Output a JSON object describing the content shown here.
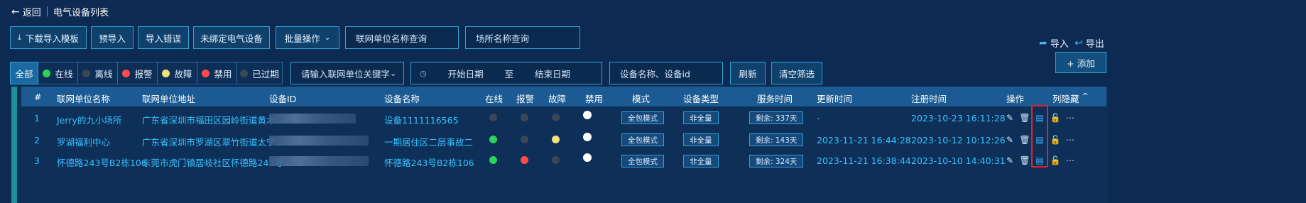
{
  "header": {
    "back_label": "返回",
    "title": "电气设备列表"
  },
  "toolbar": {
    "download_template": "下载导入模板",
    "pre_import": "预导入",
    "import_errors": "导入错误",
    "unbound": "未绑定电气设备",
    "batch": "批量操作",
    "unit_search_placeholder": "联网单位名称查询",
    "place_search_placeholder": "场所名称查询",
    "import_label": "导入",
    "export_label": "导出"
  },
  "filters": {
    "status_items": [
      {
        "label": "全部",
        "color": ""
      },
      {
        "label": "在线",
        "color": "#2bd45a"
      },
      {
        "label": "离线",
        "color": "#3b4656"
      },
      {
        "label": "报警",
        "color": "#ff4a4a"
      },
      {
        "label": "故障",
        "color": "#f3e27a"
      },
      {
        "label": "禁用",
        "color": "#ff4a4a"
      },
      {
        "label": "已过期",
        "color": "#3b4656"
      }
    ],
    "unit_keyword_placeholder": "请输入联网单位关键字",
    "start_date_placeholder": "开始日期",
    "date_sep": "至",
    "end_date_placeholder": "结束日期",
    "device_search_placeholder": "设备名称、设备id",
    "refresh_label": "刷新",
    "clear_label": "清空筛选",
    "add_label": "+ 添加"
  },
  "table": {
    "headers": {
      "index": "#",
      "unit_name": "联网单位名称",
      "unit_address": "联网单位地址",
      "device_id": "设备ID",
      "device_name": "设备名称",
      "online": "在线",
      "alarm": "报警",
      "fault": "故障",
      "disabled": "禁用",
      "mode": "模式",
      "device_type": "设备类型",
      "service_time": "服务时间",
      "update_time": "更新时间",
      "register_time": "注册时间",
      "actions": "操作",
      "column_hide": "列隐藏"
    },
    "rows": [
      {
        "index": "1",
        "unit_name": "Jerry的九小场所",
        "unit_address": "广东省深圳市福田区园岭街道黄木...",
        "device_name": "设备1111116565",
        "online_color": "#3b4656",
        "alarm_color": "#3b4656",
        "fault_color": "#3b4656",
        "disabled_color": "#ffffff",
        "mode": "全包模式",
        "device_type": "非全量",
        "service_time": "剩余: 337天",
        "update_time": "-",
        "register_time": "2023-10-23 16:11:28"
      },
      {
        "index": "2",
        "unit_name": "罗湖福利中心",
        "unit_address": "广东省深圳市罗湖区翠竹街道太宁...",
        "device_name": "一期居住区二层事故二",
        "online_color": "#2bd45a",
        "alarm_color": "#3b4656",
        "fault_color": "#f3e27a",
        "disabled_color": "#ffffff",
        "mode": "全包模式",
        "device_type": "非全量",
        "service_time": "剩余: 143天",
        "update_time": "2023-11-21 16:44:28",
        "register_time": "2023-10-12 10:12:26"
      },
      {
        "index": "3",
        "unit_name": "怀德路243号B2栋106",
        "unit_address": "东莞市虎门镇居岐社区怀德路243号...",
        "device_name": "怀德路243号B2栋106",
        "online_color": "#2bd45a",
        "alarm_color": "#ff4a4a",
        "fault_color": "#3b4656",
        "disabled_color": "#ffffff",
        "mode": "全包模式",
        "device_type": "非全量",
        "service_time": "剩余: 324天",
        "update_time": "2023-11-21 16:38:44",
        "register_time": "2023-10-10 14:40:31"
      }
    ]
  },
  "colors": {
    "accent": "#2ea3d6",
    "background": "#0c2a52",
    "highlight": "#e2232b"
  }
}
